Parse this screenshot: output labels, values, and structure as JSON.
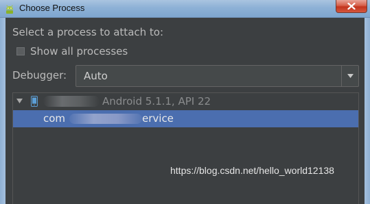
{
  "window": {
    "title": "Choose Process",
    "app_icon": "android-icon",
    "close_icon": "close-icon"
  },
  "dialog": {
    "prompt": "Select a process to attach to:",
    "show_all_label": "Show all processes",
    "show_all_checked": false,
    "debugger_label": "Debugger:",
    "debugger_value": "Auto",
    "debugger_arrow_icon": "chevron-down-icon"
  },
  "process_tree": {
    "device_label": "Android 5.1.1, API 22",
    "device_icon": "phone-icon",
    "process_prefix": "com",
    "process_suffix": "ervice"
  },
  "watermark": "https://blog.csdn.net/hello_world12138",
  "colors": {
    "background": "#3c3f41",
    "selection": "#4b6eaf",
    "text": "#bbbbbb",
    "android_green": "#a4c639"
  }
}
